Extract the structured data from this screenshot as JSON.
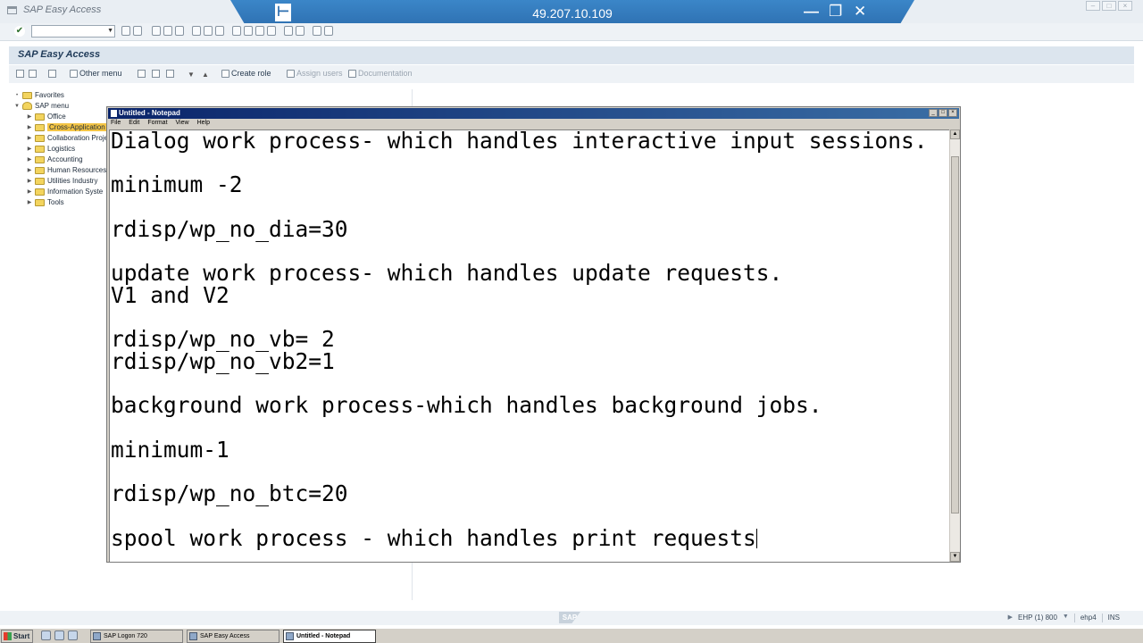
{
  "sap_window": {
    "title": "SAP Easy Access",
    "toolbar": {
      "command_field_value": ""
    }
  },
  "remote_session": {
    "host": "49.207.10.109"
  },
  "header": {
    "title": "SAP Easy Access"
  },
  "app_toolbar": {
    "other_menu": "Other menu",
    "create_role": "Create role",
    "assign_users": "Assign users",
    "documentation": "Documentation"
  },
  "tree": {
    "favorites": "Favorites",
    "sap_menu": "SAP menu",
    "items": [
      {
        "label": "Office",
        "selected": false
      },
      {
        "label": "Cross-Application C",
        "selected": true
      },
      {
        "label": "Collaboration Proje",
        "selected": false
      },
      {
        "label": "Logistics",
        "selected": false
      },
      {
        "label": "Accounting",
        "selected": false
      },
      {
        "label": "Human Resources",
        "selected": false
      },
      {
        "label": "Utilities Industry",
        "selected": false
      },
      {
        "label": "Information Syste",
        "selected": false
      },
      {
        "label": "Tools",
        "selected": false
      }
    ]
  },
  "notepad": {
    "title": "Untitled - Notepad",
    "menu": [
      "File",
      "Edit",
      "Format",
      "View",
      "Help"
    ],
    "lines": [
      "Dialog work process- which handles interactive input sessions.",
      "",
      "minimum -2",
      "",
      "rdisp/wp_no_dia=30",
      "",
      "update work process- which handles update requests.",
      "V1 and V2",
      "",
      "rdisp/wp_no_vb= 2",
      "rdisp/wp_no_vb2=1",
      "",
      "background work process-which handles background jobs.",
      "",
      "minimum-1",
      "",
      "rdisp/wp_no_btc=20",
      "",
      "spool work process - which handles print requests"
    ]
  },
  "status_bar": {
    "logo": "SAP",
    "system": "EHP (1) 800",
    "server": "ehp4",
    "mode": "INS"
  },
  "taskbar": {
    "start": "Start",
    "tasks": [
      "SAP Logon 720",
      "SAP Easy Access",
      "Untitled - Notepad"
    ],
    "active_index": 2
  }
}
